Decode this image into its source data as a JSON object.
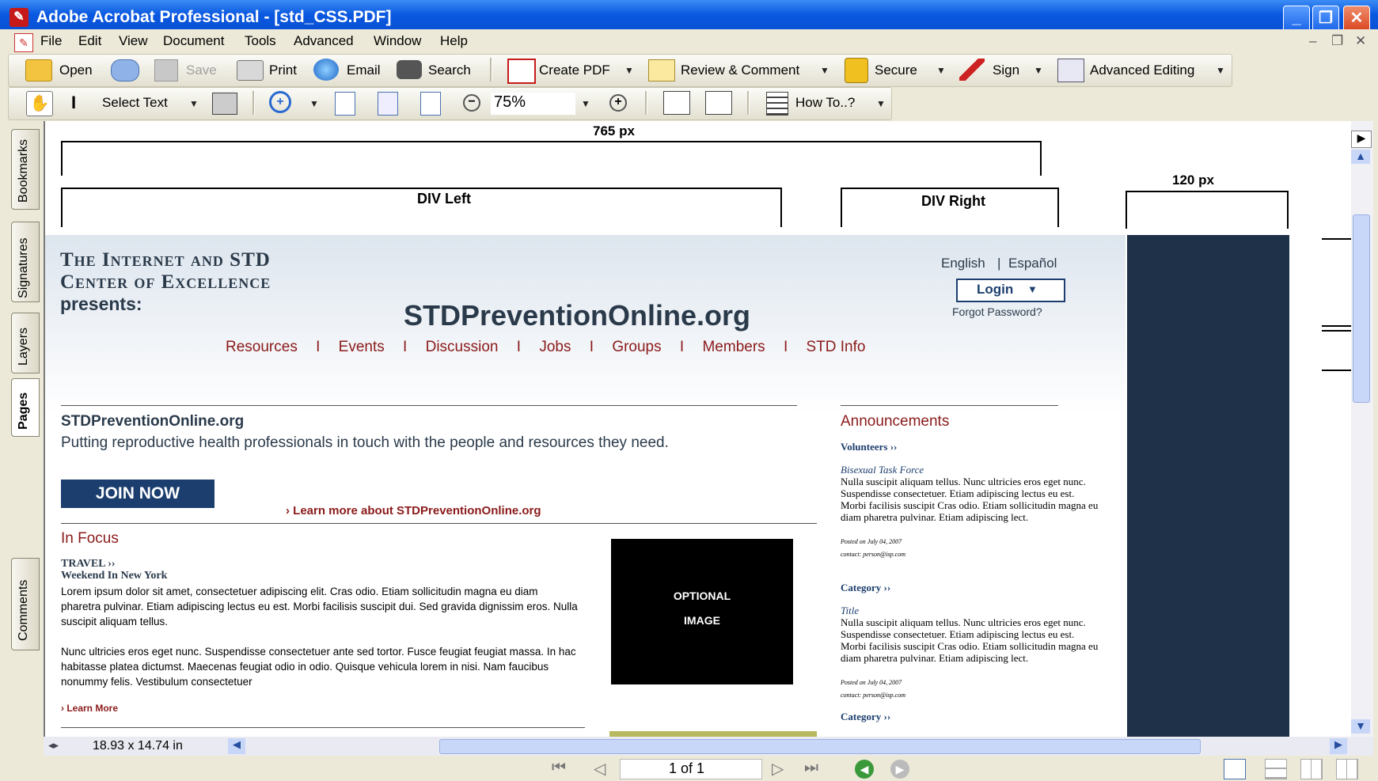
{
  "window": {
    "title": "Adobe Acrobat Professional - [std_CSS.PDF]"
  },
  "menu": [
    "File",
    "Edit",
    "View",
    "Document",
    "Tools",
    "Advanced",
    "Window",
    "Help"
  ],
  "toolbar1": {
    "open": "Open",
    "save": "Save",
    "print": "Print",
    "email": "Email",
    "search": "Search",
    "create_pdf": "Create PDF",
    "review": "Review & Comment",
    "secure": "Secure",
    "sign": "Sign",
    "advanced_editing": "Advanced Editing"
  },
  "toolbar2": {
    "select_text": "Select Text",
    "zoom": "75%",
    "how_to": "How To..?"
  },
  "side_tabs": [
    "Bookmarks",
    "Signatures",
    "Layers",
    "Pages",
    "Comments"
  ],
  "doc": {
    "w765": "765 px",
    "div_left": "DIV Left",
    "div_right": "DIV Right",
    "w120": "120 px",
    "org_line1": "The Internet and STD",
    "org_line2": "Center of Excellence",
    "org_line3": "presents:",
    "site": "STDPreventionOnline.org",
    "lang_en": "English",
    "lang_sep": "|",
    "lang_es": "Español",
    "login": "Login",
    "forgot": "Forgot Password?",
    "nav": [
      "Resources",
      "Events",
      "Discussion",
      "Jobs",
      "Groups",
      "Members",
      "STD Info"
    ],
    "nav_sep": "I",
    "tag_title": "STDPreventionOnline.org",
    "tagline": "Putting reproductive health professionals in touch with the people and resources they need.",
    "join": "JOIN NOW",
    "learn_more_org": "› Learn more about STDPreventionOnline.org",
    "in_focus": "In Focus",
    "travel": "TRAVEL ››",
    "weekend": "Weekend In New York",
    "p1": "Lorem ipsum dolor sit amet, consectetuer adipiscing elit. Cras odio. Etiam sollicitudin magna eu diam pharetra pulvinar. Etiam adipiscing lectus eu est. Morbi facilisis suscipit dui. Sed gravida dignissim eros. Nulla suscipit aliquam tellus.",
    "p2": "Nunc ultricies eros eget nunc. Suspendisse consectetuer ante sed tortor. Fusce feugiat feugiat massa. In hac habitasse platea dictumst. Maecenas feugiat odio in odio. Quisque vehicula lorem in nisi. Nam faucibus nonummy felis. Vestibulum consectetuer",
    "learn_more": "› Learn More",
    "optional": "OPTIONAL",
    "image": "IMAGE",
    "announcements": "Announcements",
    "volunteers": "Volunteers ››",
    "bisexual": "Bisexual Task Force",
    "ann_text": "Nulla suscipit aliquam tellus. Nunc ultricies eros eget nunc. Suspendisse consectetuer. Etiam adipiscing lectus eu est. Morbi facilisis suscipit Cras odio. Etiam sollicitudin magna eu diam pharetra pulvinar. Etiam adipiscing lect.",
    "posted": "Posted on July 04, 2007",
    "contact": "contact: person@isp.com",
    "category": "Category ››",
    "title_item": "Title",
    "ann_text2": "Nulla suscipit aliquam tellus. Nunc ultricies eros eget nunc. Suspendisse consectetuer. Etiam adipiscing lectus eu est. Morbi facilisis suscipit Cras odio. Etiam sollicitudin magna eu diam pharetra pulvinar. Etiam adipiscing lect.",
    "posted2": "Posted on July 04, 2007",
    "contact2": "contact: person@isp.com",
    "category2": "Category ››"
  },
  "status": {
    "page_size": "18.93 x 14.74 in",
    "page": "1 of 1"
  },
  "colors": {
    "accent": "#0851d6",
    "brand_red": "#8b1a1a",
    "join_blue": "#1c3e6e",
    "dark_column": "#1f3148"
  }
}
